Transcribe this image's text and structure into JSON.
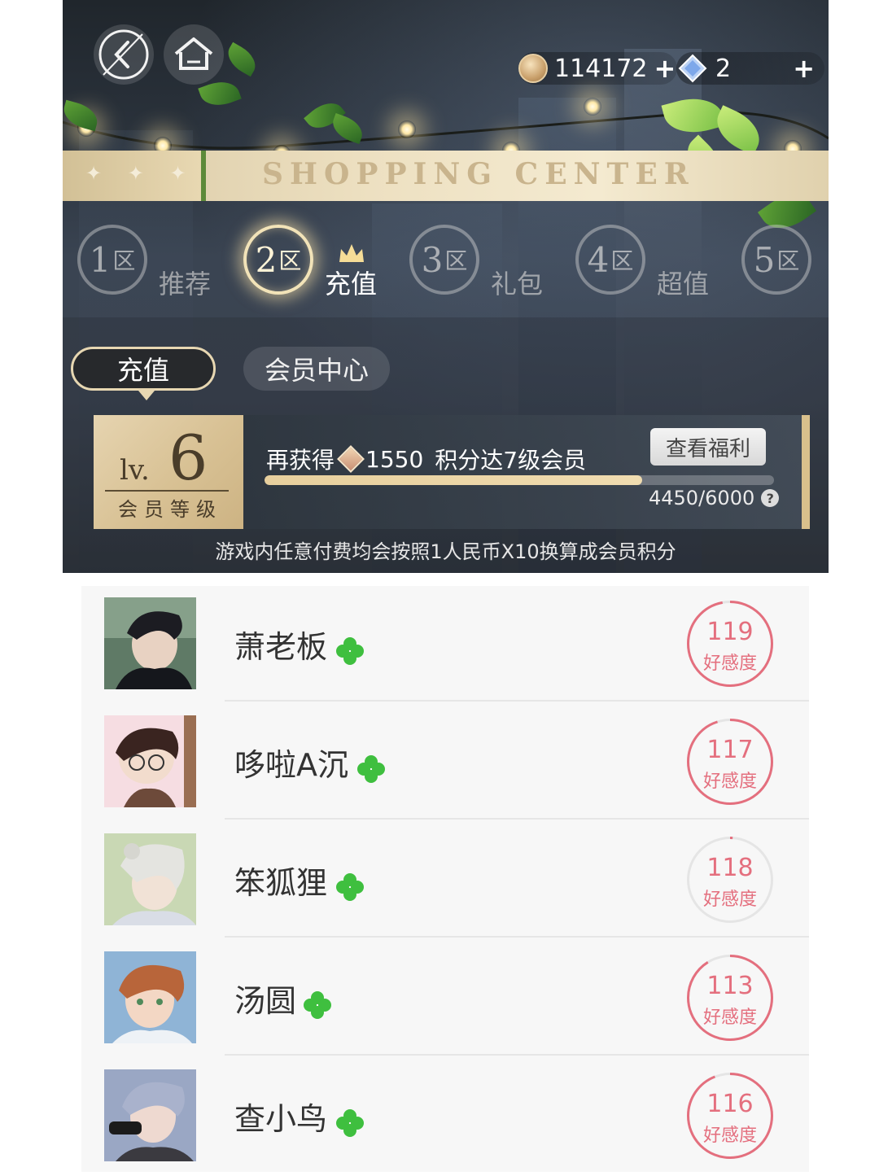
{
  "shop": {
    "banner_title": "SHOPPING CENTER",
    "banner_stars": "✦ ✦ ✦",
    "coins": "114172",
    "gems": "2",
    "plus_glyph": "+",
    "zones": [
      {
        "num": "1",
        "unit": "区",
        "label": "推荐",
        "active": false
      },
      {
        "num": "2",
        "unit": "区",
        "label": "充值",
        "active": true
      },
      {
        "num": "3",
        "unit": "区",
        "label": "礼包",
        "active": false
      },
      {
        "num": "4",
        "unit": "区",
        "label": "超值",
        "active": false
      },
      {
        "num": "5",
        "unit": "区",
        "label": "",
        "active": false
      }
    ],
    "tabs": {
      "recharge": "充值",
      "member_center": "会员中心"
    },
    "vip": {
      "level_prefix": "lv.",
      "level": "6",
      "level_caption": "会员等级",
      "msg_prefix": "再获得",
      "msg_points": "1550",
      "msg_suffix": "积分达7级会员",
      "benefit_button": "查看福利",
      "progress_text": "4450/6000",
      "progress_fraction": 0.7417,
      "help_glyph": "?",
      "note": "游戏内任意付费均会按照1人民币X10换算成会员积分"
    },
    "icons": {
      "back": "back-arrow-icon",
      "home": "home-icon",
      "coin": "gold-coin-icon",
      "gem": "blue-diamond-icon",
      "crown": "crown-icon"
    }
  },
  "friends": [
    {
      "name": "萧老板",
      "favor": "119",
      "favor_label": "好感度",
      "favor_fraction": 0.97
    },
    {
      "name": "哆啦A沉",
      "favor": "117",
      "favor_label": "好感度",
      "favor_fraction": 0.95
    },
    {
      "name": "笨狐狸",
      "favor": "118",
      "favor_label": "好感度",
      "favor_fraction": 0.01
    },
    {
      "name": "汤圆",
      "favor": "113",
      "favor_label": "好感度",
      "favor_fraction": 0.91
    },
    {
      "name": "查小鸟",
      "favor": "116",
      "favor_label": "好感度",
      "favor_fraction": 0.94
    }
  ],
  "colors": {
    "favor_accent": "#e46f7e",
    "clover": "#3fbf3f",
    "gold": "#e7cf9d"
  }
}
